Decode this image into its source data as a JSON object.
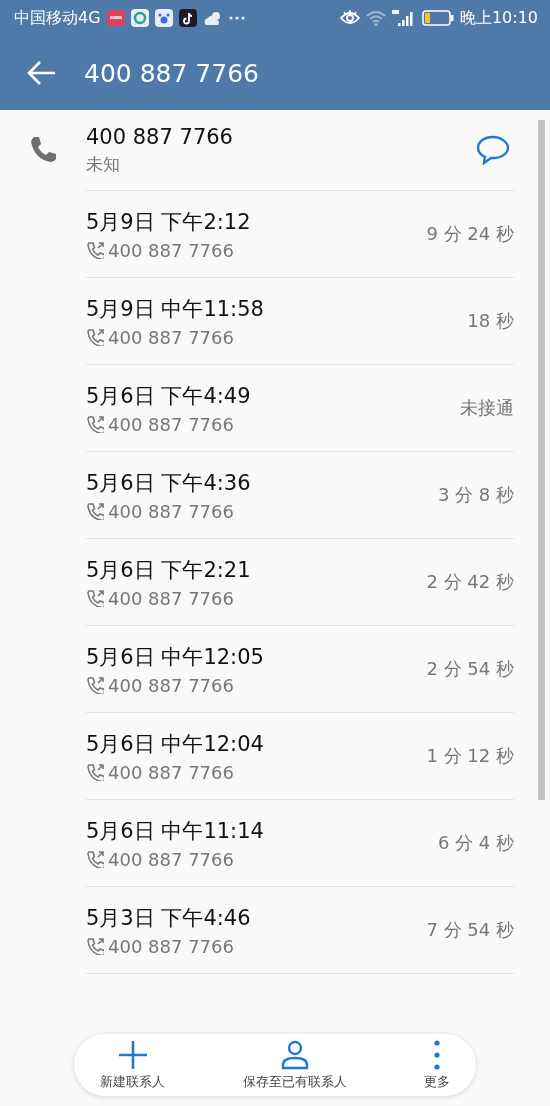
{
  "status_bar": {
    "carrier": "中国移动4G",
    "time": "晚上10:10"
  },
  "header": {
    "title": "400 887 7766"
  },
  "contact": {
    "number": "400 887 7766",
    "label": "未知"
  },
  "calls": [
    {
      "date": "5月9日 下午2:12",
      "number": "400 887 7766",
      "duration": "9 分 24 秒"
    },
    {
      "date": "5月9日 中午11:58",
      "number": "400 887 7766",
      "duration": "18 秒"
    },
    {
      "date": "5月6日 下午4:49",
      "number": "400 887 7766",
      "duration": "未接通"
    },
    {
      "date": "5月6日 下午4:36",
      "number": "400 887 7766",
      "duration": "3 分 8 秒"
    },
    {
      "date": "5月6日 下午2:21",
      "number": "400 887 7766",
      "duration": "2 分 42 秒"
    },
    {
      "date": "5月6日 中午12:05",
      "number": "400 887 7766",
      "duration": "2 分 54 秒"
    },
    {
      "date": "5月6日 中午12:04",
      "number": "400 887 7766",
      "duration": "1 分 12 秒"
    },
    {
      "date": "5月6日 中午11:14",
      "number": "400 887 7766",
      "duration": "6 分 4 秒"
    },
    {
      "date": "5月3日 下午4:46",
      "number": "400 887 7766",
      "duration": "7 分 54 秒"
    }
  ],
  "actions": [
    {
      "kind": "add",
      "label": "新建联系人"
    },
    {
      "kind": "person",
      "label": "保存至已有联系人"
    },
    {
      "kind": "more",
      "label": "更多"
    }
  ]
}
